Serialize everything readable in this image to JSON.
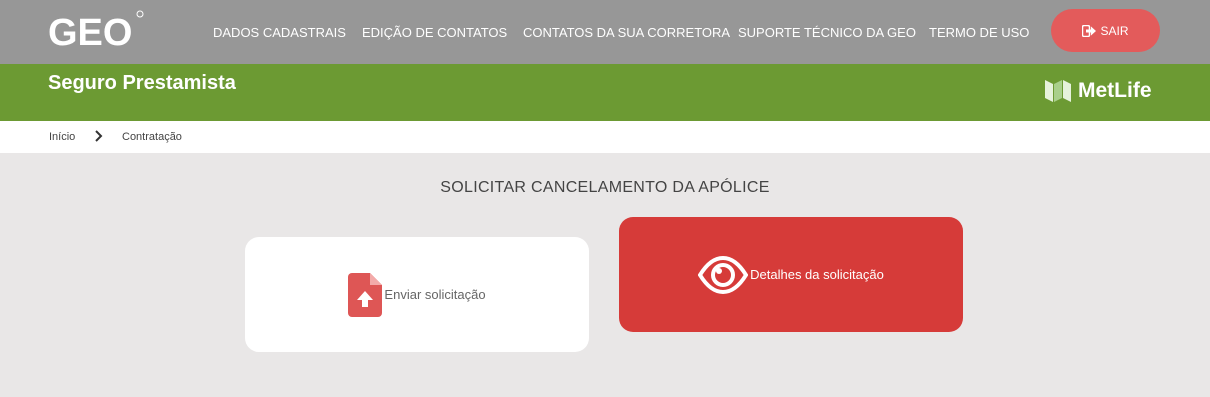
{
  "header": {
    "logo": "GEO",
    "nav": [
      "DADOS CADASTRAIS",
      "EDIÇÃO DE CONTATOS",
      "CONTATOS DA SUA CORRETORA",
      "SUPORTE TÉCNICO DA GEO",
      "TERMO DE USO"
    ],
    "logout_label": "SAIR"
  },
  "banner": {
    "title": "Seguro Prestamista",
    "partner": "MetLife"
  },
  "breadcrumb": {
    "home": "Início",
    "current": "Contratação"
  },
  "main": {
    "heading": "SOLICITAR CANCELAMENTO DA APÓLICE",
    "send_label": "Enviar solicitação",
    "details_label": "Detalhes da solicitação"
  },
  "colors": {
    "topbar": "#979797",
    "green": "#6c9a33",
    "red": "#d63b39",
    "logout": "#e35b5b"
  }
}
